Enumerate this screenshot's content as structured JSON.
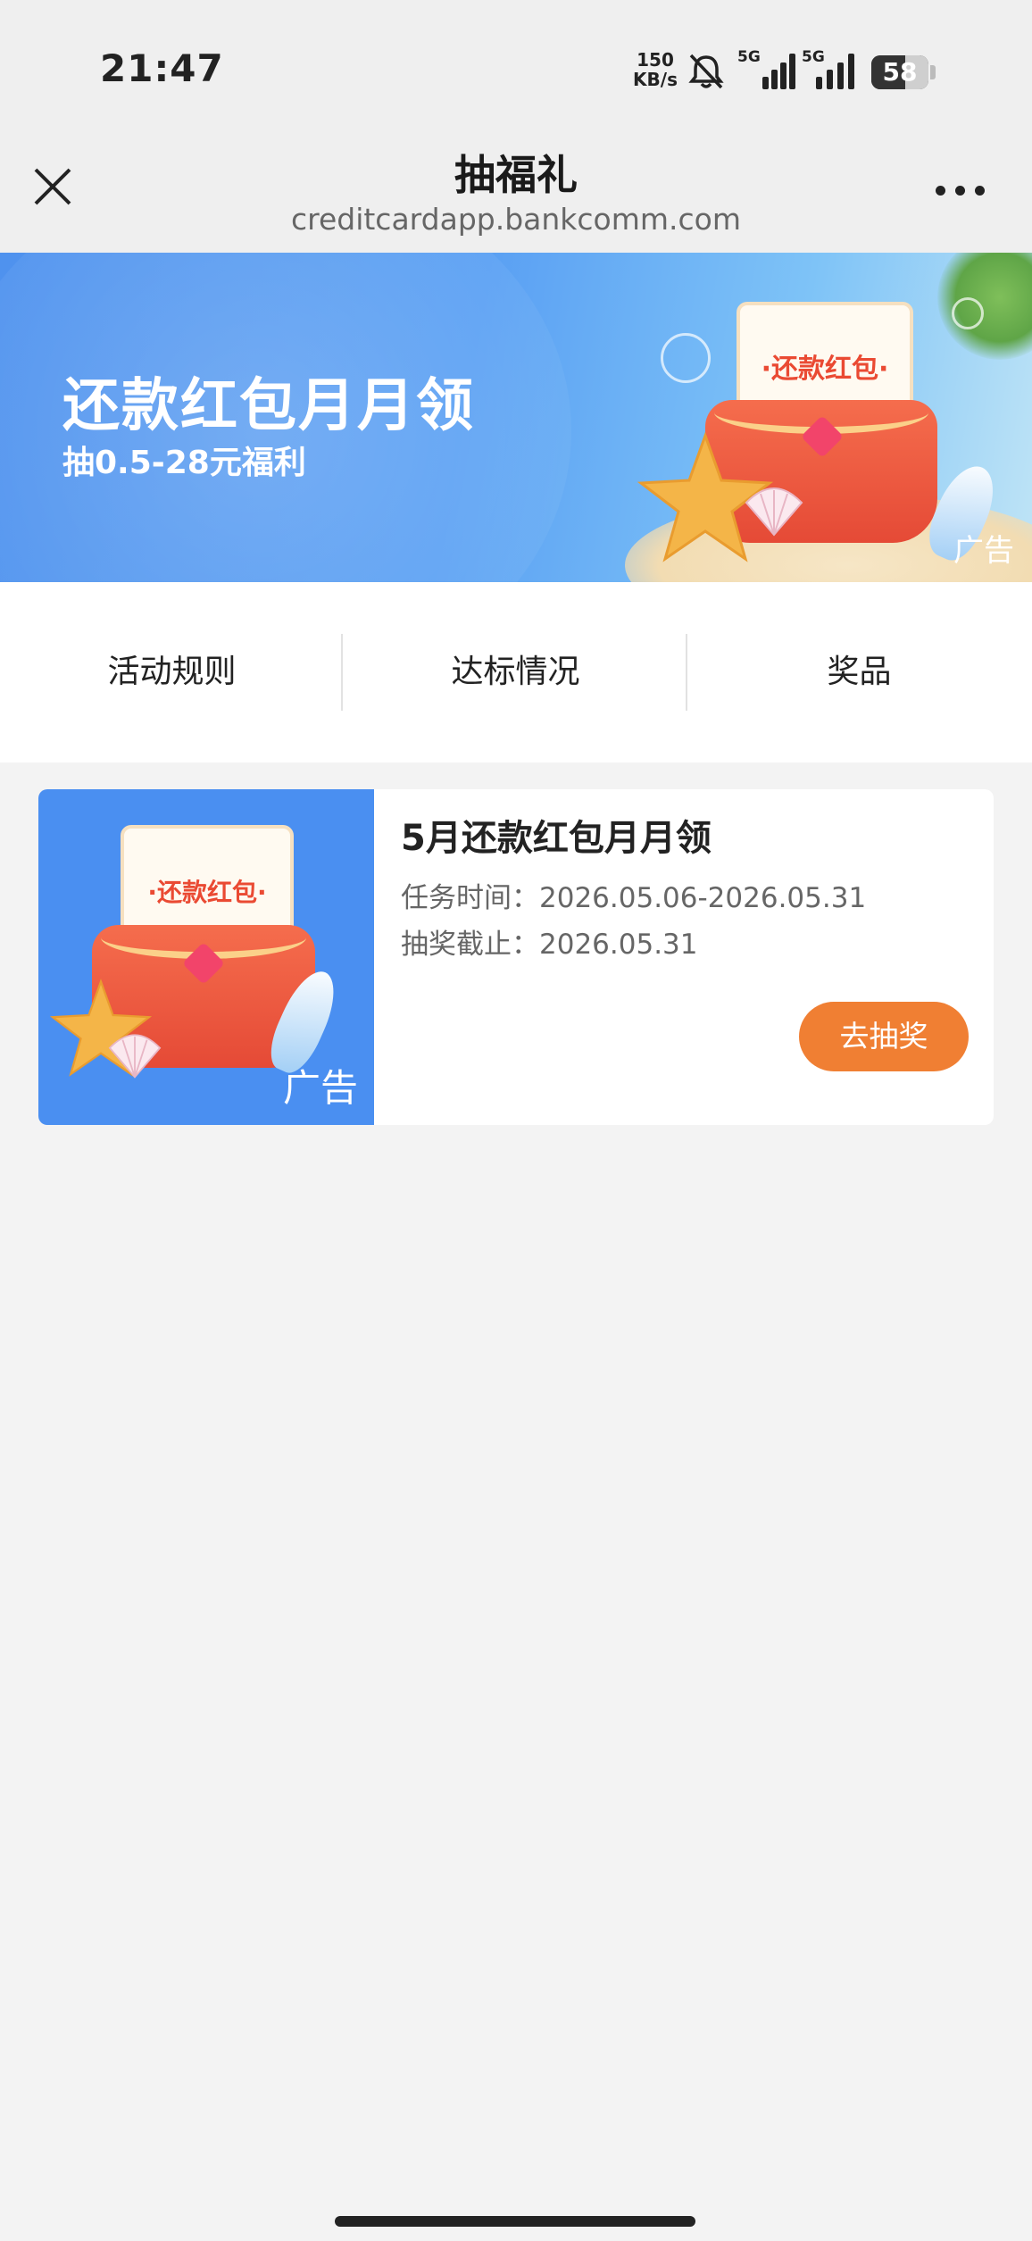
{
  "status_bar": {
    "time": "21:47",
    "net_speed_value": "150",
    "net_speed_unit": "KB/s",
    "sim1_label": "5G",
    "sim2_label": "5G",
    "battery": "58"
  },
  "header": {
    "title": "抽福礼",
    "url": "creditcardapp.bankcomm.com"
  },
  "banner": {
    "title": "还款红包月月领",
    "subtitle": "抽0.5-28元福利",
    "envelope_text": "·还款红包·",
    "ad_label": "广告"
  },
  "tabs": [
    {
      "label": "活动规则"
    },
    {
      "label": "达标情况"
    },
    {
      "label": "奖品"
    }
  ],
  "card": {
    "title": "5月还款红包月月领",
    "task_time": "任务时间：2026.05.06-2026.05.31",
    "deadline": "抽奖截止：2026.05.31",
    "button_label": "去抽奖",
    "thumb_envelope_text": "·还款红包·",
    "thumb_ad_label": "广告"
  },
  "colors": {
    "accent_orange": "#f07f33",
    "banner_blue": "#4f92ee",
    "envelope_red": "#f0583e"
  }
}
